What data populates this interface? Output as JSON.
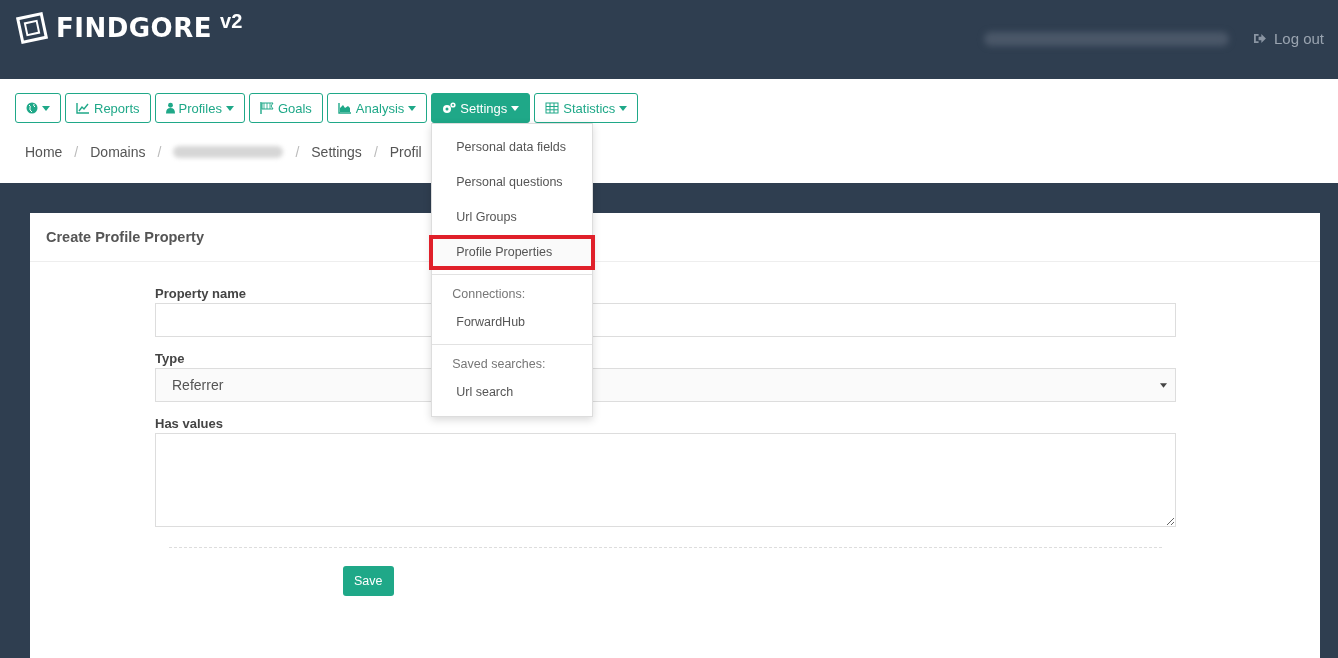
{
  "brand": {
    "name": "FINDGORE",
    "version": "v2"
  },
  "header": {
    "logout": "Log out"
  },
  "nav": [
    {
      "caret": true,
      "active": false
    },
    {
      "label": "Reports",
      "caret": false,
      "active": false
    },
    {
      "label": "Profiles",
      "caret": true,
      "active": false
    },
    {
      "label": "Goals",
      "caret": false,
      "active": false
    },
    {
      "label": "Analysis",
      "caret": true,
      "active": false
    },
    {
      "label": "Settings",
      "caret": true,
      "active": true
    },
    {
      "label": "Statistics",
      "caret": true,
      "active": false
    }
  ],
  "menu": [
    {
      "kind": "item",
      "label": "Personal data fields",
      "selected": false
    },
    {
      "kind": "item",
      "label": "Personal questions",
      "selected": false
    },
    {
      "kind": "item",
      "label": "Url Groups",
      "selected": false
    },
    {
      "kind": "item",
      "label": "Profile Properties",
      "selected": true
    },
    {
      "kind": "divider"
    },
    {
      "kind": "header",
      "label": "Connections:"
    },
    {
      "kind": "item",
      "label": "ForwardHub",
      "selected": false
    },
    {
      "kind": "divider"
    },
    {
      "kind": "header",
      "label": "Saved searches:"
    },
    {
      "kind": "item",
      "label": "Url search",
      "selected": false
    }
  ],
  "breadcrumb_separator": "/",
  "breadcrumb": [
    {
      "kind": "link",
      "label": "Home"
    },
    {
      "kind": "link",
      "label": "Domains"
    },
    {
      "kind": "redacted"
    },
    {
      "kind": "link",
      "label": "Settings"
    },
    {
      "kind": "current",
      "label": "Profil"
    }
  ],
  "card": {
    "title": "Create Profile Property"
  },
  "form": [
    {
      "kind": "text",
      "label": "Property name"
    },
    {
      "kind": "select",
      "label": "Type",
      "value": "Referrer"
    },
    {
      "kind": "textarea",
      "label": "Has values"
    }
  ],
  "save": "Save"
}
